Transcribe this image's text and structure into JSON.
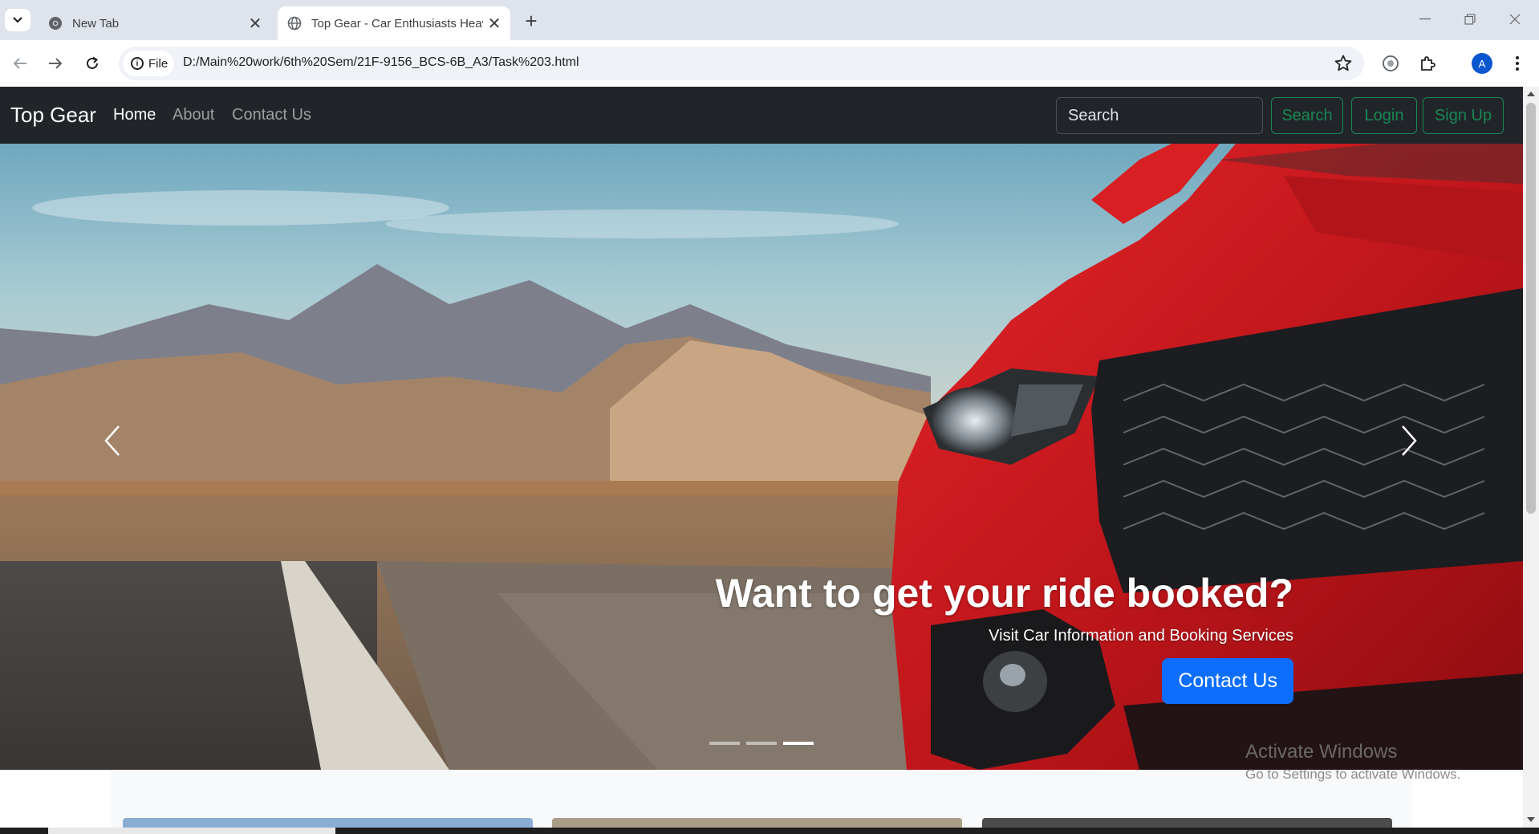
{
  "browser": {
    "tabs": [
      {
        "title": "New Tab"
      },
      {
        "title": "Top Gear - Car Enthusiasts Heaven"
      }
    ],
    "address": {
      "chip": "File",
      "url": "D:/Main%20work/6th%20Sem/21F-9156_BCS-6B_A3/Task%203.html"
    },
    "profile_initial": "A"
  },
  "navbar": {
    "brand": "Top Gear",
    "links": [
      {
        "label": "Home"
      },
      {
        "label": "About"
      },
      {
        "label": "Contact Us"
      }
    ],
    "search_placeholder": "Search",
    "search_button": "Search",
    "login_button": "Login",
    "signup_button": "Sign Up",
    "accent_color": "#198754"
  },
  "carousel": {
    "heading": "Want to get your ride booked?",
    "subtext": "Visit Car Information and Booking Services",
    "cta_label": "Contact Us",
    "slide_count": 3,
    "active_slide": 3,
    "cta_color": "#0d6efd"
  },
  "overlay": {
    "line1": "Activate Windows",
    "line2": "Go to Settings to activate Windows."
  }
}
